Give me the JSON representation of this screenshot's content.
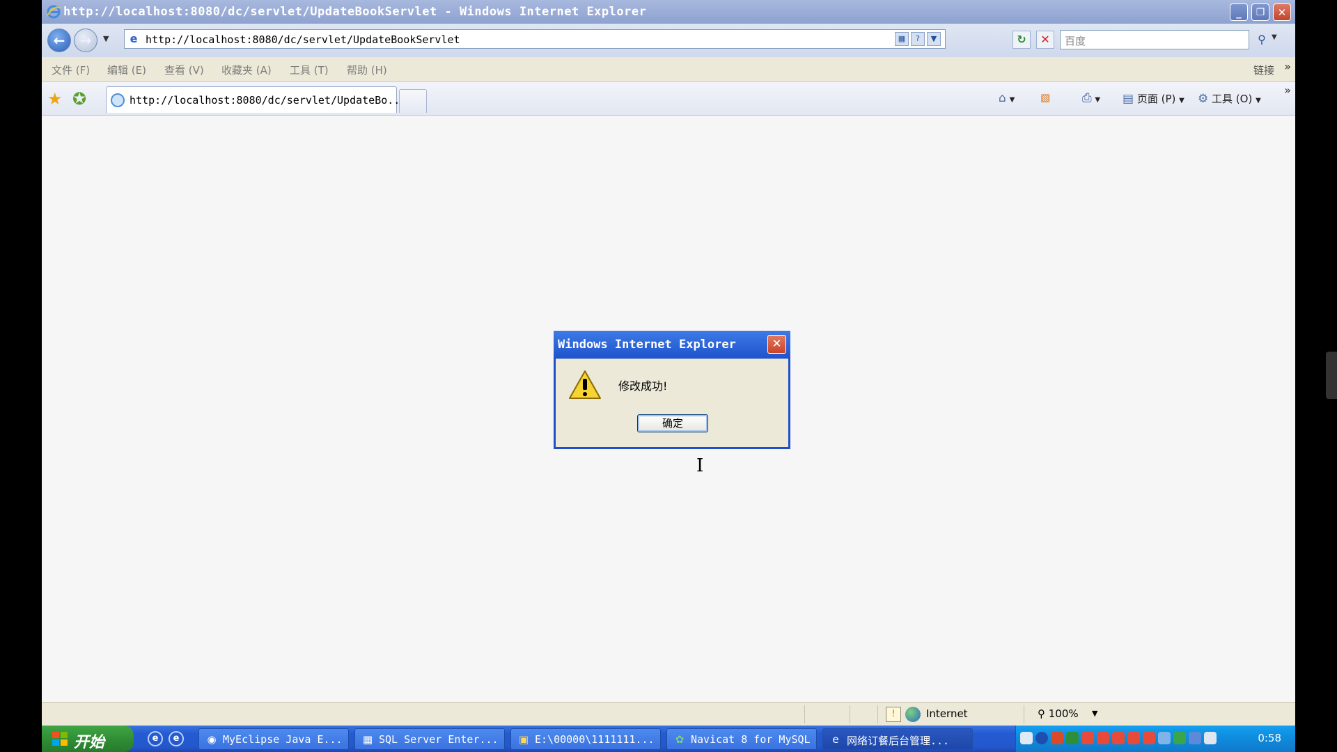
{
  "window": {
    "title": "http://localhost:8080/dc/servlet/UpdateBookServlet - Windows Internet Explorer",
    "minimize": "_",
    "restore": "❐",
    "close": "✕"
  },
  "address_bar": {
    "url": "http://localhost:8080/dc/servlet/UpdateBookServlet",
    "search_placeholder": "百度"
  },
  "menu": {
    "items": [
      "文件 (F)",
      "编辑 (E)",
      "查看 (V)",
      "收藏夹 (A)",
      "工具 (T)",
      "帮助 (H)"
    ],
    "links_label": "链接"
  },
  "tabs": {
    "active_label": "http://localhost:8080/dc/servlet/UpdateBo..."
  },
  "command_bar": {
    "page_label": "页面 (P)",
    "tools_label": "工具 (O)"
  },
  "dialog": {
    "title": "Windows Internet Explorer",
    "message": "修改成功!",
    "ok_label": "确定",
    "close": "✕"
  },
  "status_bar": {
    "zone": "Internet",
    "zoom": "100%"
  },
  "taskbar": {
    "start_label": "开始",
    "tasks": [
      {
        "label": "MyEclipse Java E...",
        "icon": "myeclipse-icon"
      },
      {
        "label": "SQL Server Enter...",
        "icon": "sql-server-icon"
      },
      {
        "label": "E:\\00000\\1111111...",
        "icon": "folder-icon"
      },
      {
        "label": "Navicat 8 for MySQL",
        "icon": "navicat-icon"
      },
      {
        "label": "网络订餐后台管理...",
        "icon": "ie-icon"
      }
    ],
    "clock": "0:58"
  }
}
